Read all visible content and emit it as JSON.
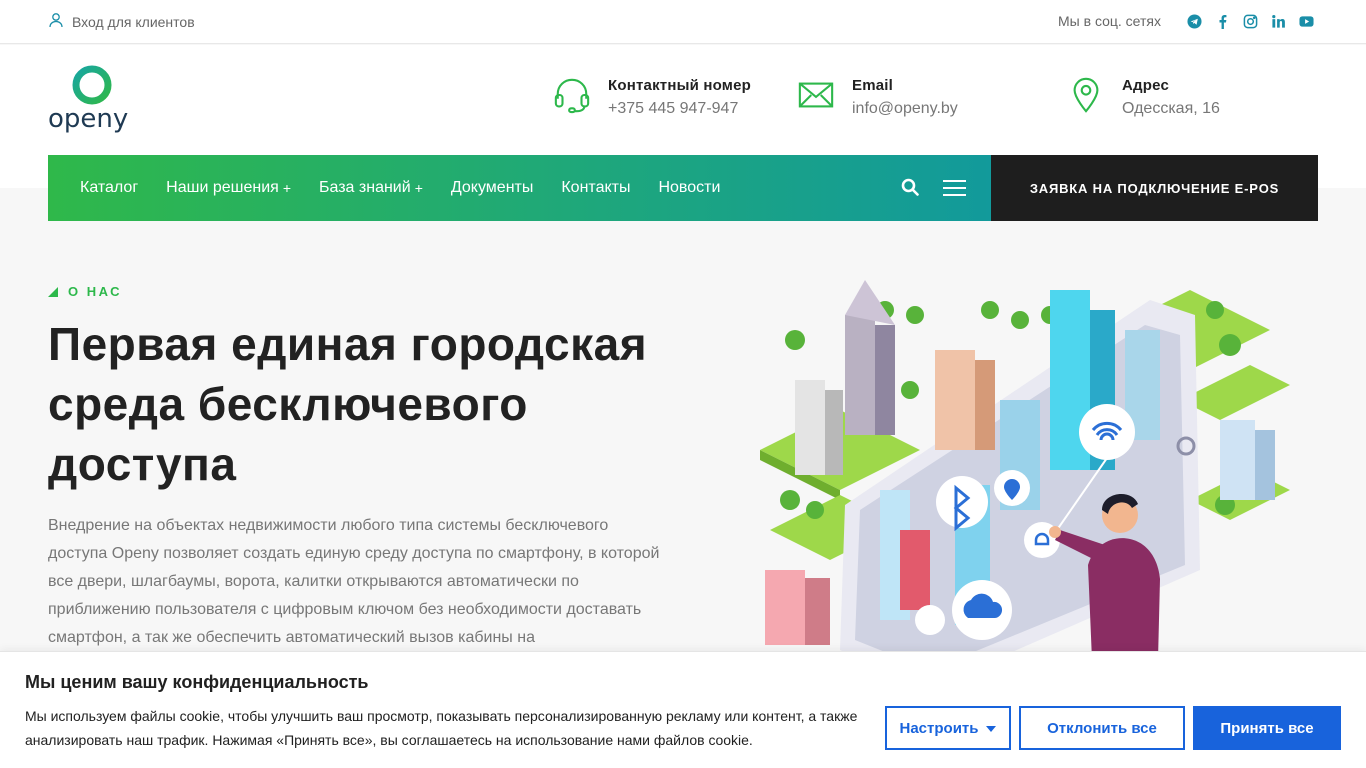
{
  "topbar": {
    "login_label": "Вход для клиентов",
    "social_label": "Мы в соц. сетях",
    "socials": [
      "telegram-icon",
      "facebook-icon",
      "instagram-icon",
      "linkedin-icon",
      "youtube-icon"
    ]
  },
  "header": {
    "contacts": [
      {
        "title": "Контактный номер",
        "value": "+375 445 947-947",
        "icon": "headset-icon"
      },
      {
        "title": "Email",
        "value": "info@openy.by",
        "icon": "mail-icon"
      },
      {
        "title": "Адрес",
        "value": "Одесская, 16",
        "icon": "map-pin-icon"
      }
    ],
    "logo_text": "openy"
  },
  "nav": {
    "items": [
      {
        "label": "Каталог",
        "has_sub": false
      },
      {
        "label": "Наши решения",
        "has_sub": true
      },
      {
        "label": "База знаний",
        "has_sub": true
      },
      {
        "label": "Документы",
        "has_sub": false
      },
      {
        "label": "Контакты",
        "has_sub": false
      },
      {
        "label": "Новости",
        "has_sub": false
      }
    ],
    "plus": "+",
    "cta_label": "ЗАЯВКА НА ПОДКЛЮЧЕНИЕ E-POS"
  },
  "hero": {
    "eyebrow": "О НАС",
    "title": "Первая единая городская среда бесключевого доступа",
    "text": "Внедрение на объектах недвижимости любого типа системы бесключевого доступа Openy позволяет создать единую среду доступа по смартфону, в которой все двери, шлагбаумы, ворота, калитки открываются автоматически по приближению пользователя с цифровым ключом без необходимости доставать смартфон, а так же обеспечить автоматический вызов кабины на"
  },
  "cookie": {
    "title": "Мы ценим вашу конфиденциальность",
    "text": "Мы используем файлы cookie, чтобы улучшить ваш просмотр, показывать персонализированную рекламу или контент, а также анализировать наш трафик. Нажимая «Принять все», вы соглашаетесь на использование нами файлов cookie.",
    "customize_label": "Настроить",
    "reject_label": "Отклонить все",
    "accept_label": "Принять все"
  },
  "colors": {
    "brand_green": "#2db84b",
    "brand_teal": "#129a9b",
    "accent_blue": "#1863dc",
    "dark": "#1e1e1e"
  }
}
